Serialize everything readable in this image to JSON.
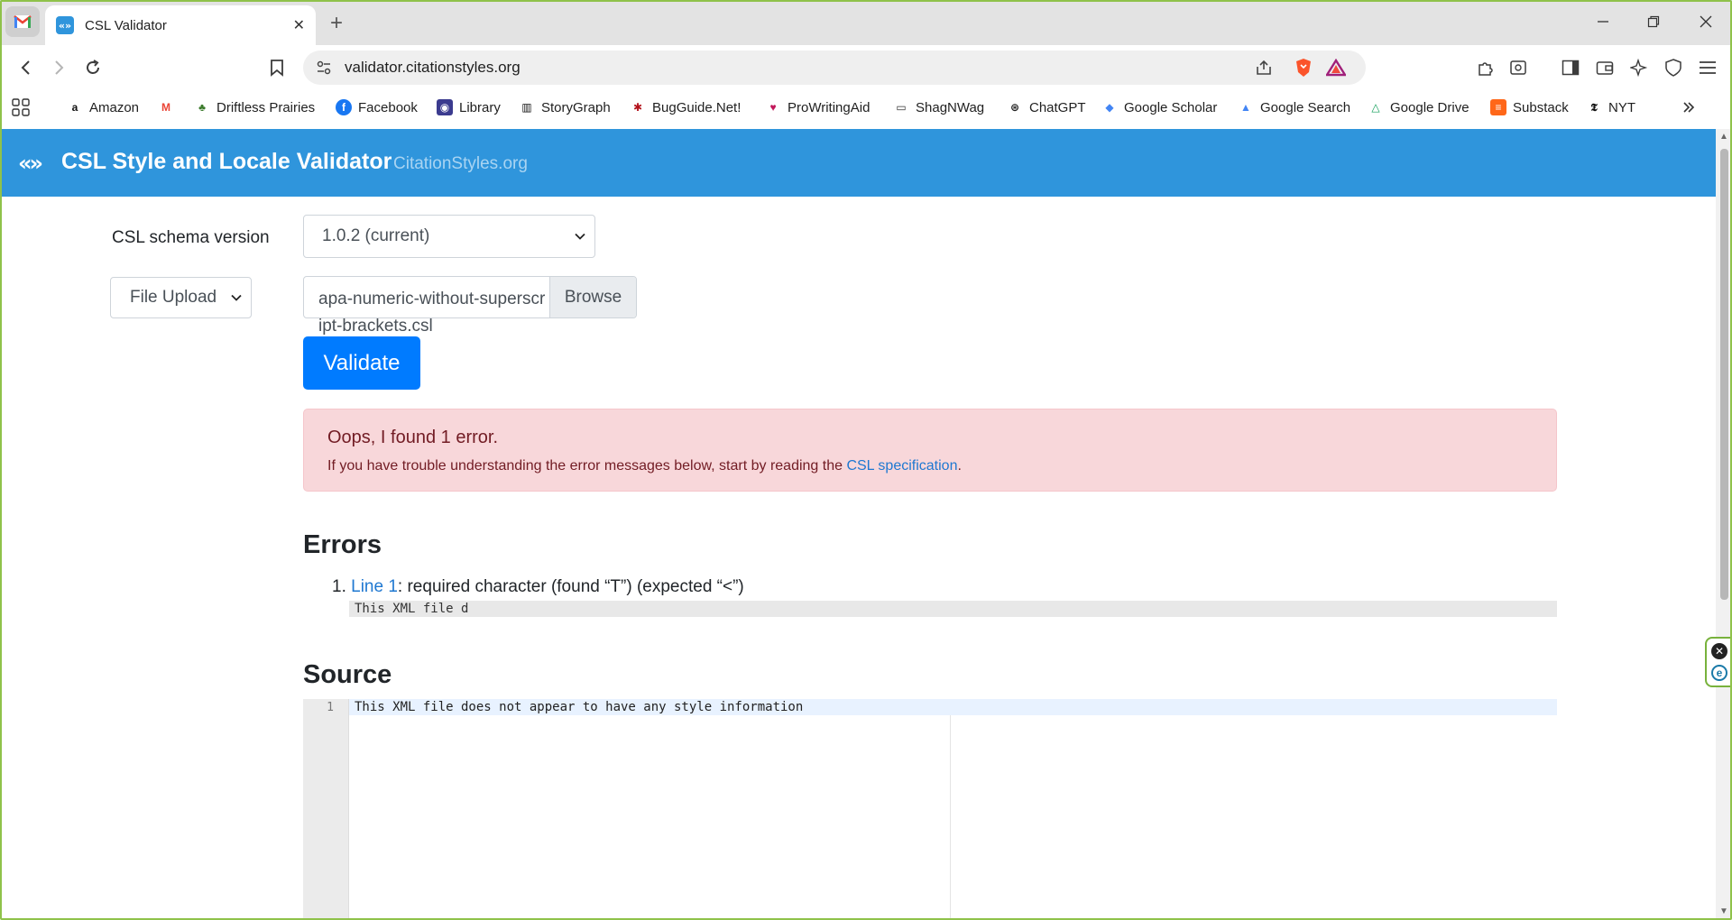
{
  "browser": {
    "tab_title": "CSL Validator",
    "url": "validator.citationstyles.org",
    "new_tab_glyph": "+",
    "tab_close_glyph": "✕"
  },
  "bookmarks": [
    {
      "label": "Amazon",
      "icon": "a"
    },
    {
      "label": "",
      "icon": "M"
    },
    {
      "label": "Driftless Prairies",
      "icon": "♣"
    },
    {
      "label": "Facebook",
      "icon": "f"
    },
    {
      "label": "Library",
      "icon": "◉"
    },
    {
      "label": "StoryGraph",
      "icon": "▥"
    },
    {
      "label": "BugGuide.Net!",
      "icon": "✱"
    },
    {
      "label": "ProWritingAid",
      "icon": "♥"
    },
    {
      "label": "ShagNWag",
      "icon": "▭"
    },
    {
      "label": "ChatGPT",
      "icon": "⊛"
    },
    {
      "label": "Google Scholar",
      "icon": "◆"
    },
    {
      "label": "Google Search",
      "icon": "▲"
    },
    {
      "label": "Google Drive",
      "icon": "△"
    },
    {
      "label": "Substack",
      "icon": "≡"
    },
    {
      "label": "NYT",
      "icon": "𝕿"
    }
  ],
  "site": {
    "logo_glyph": "«»",
    "title": "CSL Style and Locale Validator",
    "link": "CitationStyles.org"
  },
  "form": {
    "schema_label": "CSL schema version",
    "schema_value": "1.0.2 (current)",
    "source_type": "File Upload",
    "file_name": "apa-numeric-without-superscript-brackets.csl",
    "browse_label": "Browse",
    "validate_label": "Validate"
  },
  "alert": {
    "heading": "Oops, I found 1 error.",
    "body_prefix": "If you have trouble understanding the error messages below, start by reading the ",
    "link": "CSL specification",
    "body_suffix": "."
  },
  "errors": {
    "title": "Errors",
    "items": [
      {
        "number": "1.",
        "link": "Line 1",
        "message": ": required character (found “T”) (expected “<”)",
        "snippet": "This XML file d"
      }
    ]
  },
  "source": {
    "title": "Source",
    "lines": [
      {
        "number": "1",
        "text": "This XML file does not appear to have any style information"
      }
    ]
  },
  "colors": {
    "header": "#2f95dc",
    "primary_button": "#007bff",
    "alert_bg": "#f8d7da",
    "alert_text": "#721c24",
    "link": "#1f78d1",
    "window_border": "#8fc24a"
  }
}
